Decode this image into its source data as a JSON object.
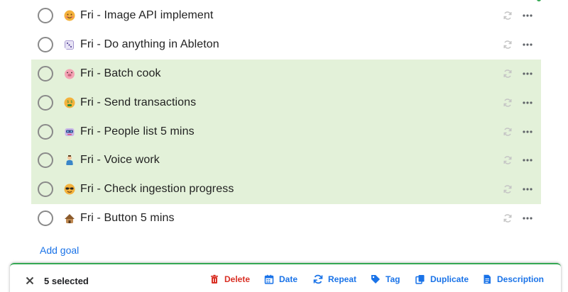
{
  "tasks": [
    {
      "label": "Fri - Image API implement",
      "emoji": "smiling-face-icon",
      "selected": false
    },
    {
      "label": "Fri - Do anything in Ableton",
      "emoji": "dice-icon",
      "selected": false
    },
    {
      "label": "Fri - Batch cook",
      "emoji": "pig-face-icon",
      "selected": true
    },
    {
      "label": "Fri - Send transactions",
      "emoji": "money-mouth-face-icon",
      "selected": true
    },
    {
      "label": "Fri - People list 5 mins",
      "emoji": "robot-face-icon",
      "selected": true
    },
    {
      "label": "Fri - Voice work",
      "emoji": "person-icon",
      "selected": true
    },
    {
      "label": "Fri - Check ingestion progress",
      "emoji": "sunglasses-face-icon",
      "selected": true
    },
    {
      "label": "Fri - Button 5 mins",
      "emoji": "hut-icon",
      "selected": false
    }
  ],
  "add_goal_label": "Add goal",
  "selection_bar": {
    "count_label": "5 selected",
    "actions": {
      "delete": "Delete",
      "date": "Date",
      "repeat": "Repeat",
      "tag": "Tag",
      "duplicate": "Duplicate",
      "description": "Description"
    }
  },
  "colors": {
    "selected_row_bg": "#e3f1d9",
    "accent_blue": "#1a73e8",
    "delete_red": "#d93025",
    "bar_top_border": "#34a853"
  }
}
